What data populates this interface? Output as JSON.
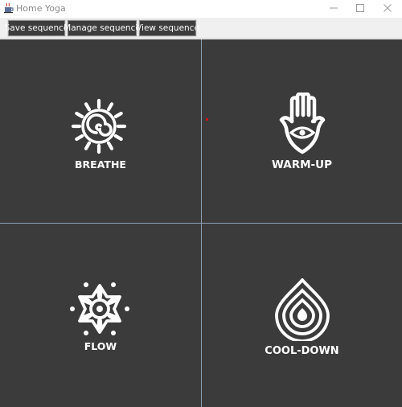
{
  "window": {
    "title": "Home Yoga",
    "app_icon": "java-cup-icon",
    "controls": [
      "minimize-icon",
      "maximize-icon",
      "close-icon"
    ]
  },
  "toolbar": {
    "save_label": "Save sequence",
    "manage_label": "Manage sequence",
    "view_label": "View sequence"
  },
  "tiles": [
    {
      "label": "BREATHE",
      "icon": "sun-spiral-icon"
    },
    {
      "label": "WARM-UP",
      "icon": "hamsa-hand-icon"
    },
    {
      "label": "FLOW",
      "icon": "mandala-flower-icon"
    },
    {
      "label": "COOL-DOWN",
      "icon": "water-drop-icon"
    }
  ],
  "colors": {
    "tile_background": "#3b3b3b",
    "divider": "#8fa0b3",
    "button_background": "#3d3d3d",
    "text": "#ffffff"
  }
}
